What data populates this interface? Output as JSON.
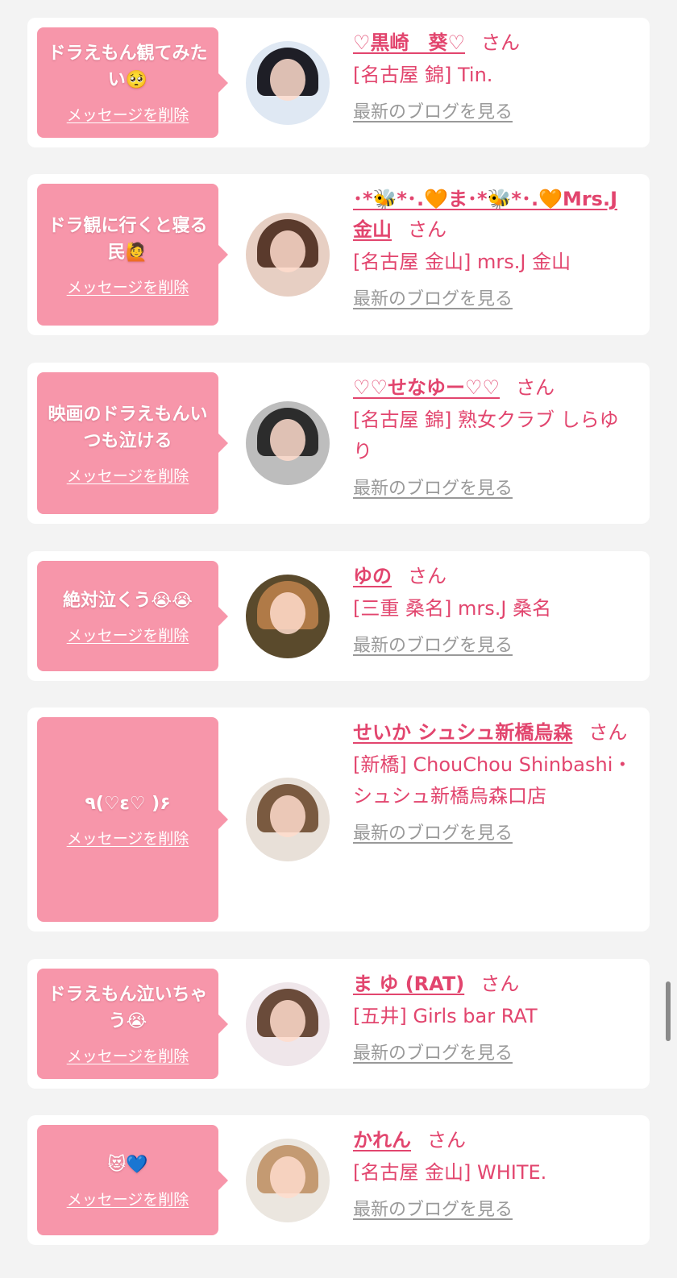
{
  "colors": {
    "background": "#f3f3f3",
    "card": "#ffffff",
    "bubble": "#f796aa",
    "accent": "#e2456e",
    "muted_link": "#999999"
  },
  "labels": {
    "delete": "メッセージを削除",
    "honorific": "さん",
    "blog": "最新のブログを見る"
  },
  "messages": [
    {
      "text": "ドラえもん観てみたい🥺",
      "name": "♡黒崎　葵♡",
      "shop": "[名古屋 錦] Tin.",
      "avatar_colors": [
        "#dfe8f3",
        "#1e1e26"
      ]
    },
    {
      "text": "ドラ観に行くと寝る民🙋",
      "name": "･*🐝*･.🧡ま･*🐝*･.🧡Mrs.J金山",
      "shop": "[名古屋 金山] mrs.J 金山",
      "avatar_colors": [
        "#e7cfc3",
        "#5a3a2c"
      ]
    },
    {
      "text": "映画のドラえもんいつも泣ける",
      "name": "♡♡せなゆー♡♡",
      "shop": "[名古屋 錦] 熟女クラブ しらゆり",
      "avatar_colors": [
        "#bdbdbd",
        "#2c2c2c"
      ]
    },
    {
      "text": "絶対泣くう😭😭",
      "name": "ゆの",
      "shop": "[三重 桑名] mrs.J 桑名",
      "avatar_colors": [
        "#5a4a2c",
        "#b07a47"
      ]
    },
    {
      "text": "٩(♡ε♡ )۶",
      "name": "せいか シュシュ新橋烏森",
      "shop": "[新橋] ChouChou Shinbashi・シュシュ新橋烏森口店",
      "avatar_colors": [
        "#e8e0d8",
        "#7a5a40"
      ]
    },
    {
      "text": "ドラえもん泣いちゃう😭",
      "name": "ま ゆ (RAT)",
      "shop": "[五井] Girls bar RAT",
      "avatar_colors": [
        "#efe6ea",
        "#6a4b3a"
      ]
    },
    {
      "text": "😻💙",
      "name": "かれん",
      "shop": "[名古屋 金山] WHITE.",
      "avatar_colors": [
        "#ebe6df",
        "#c49a72"
      ]
    }
  ]
}
